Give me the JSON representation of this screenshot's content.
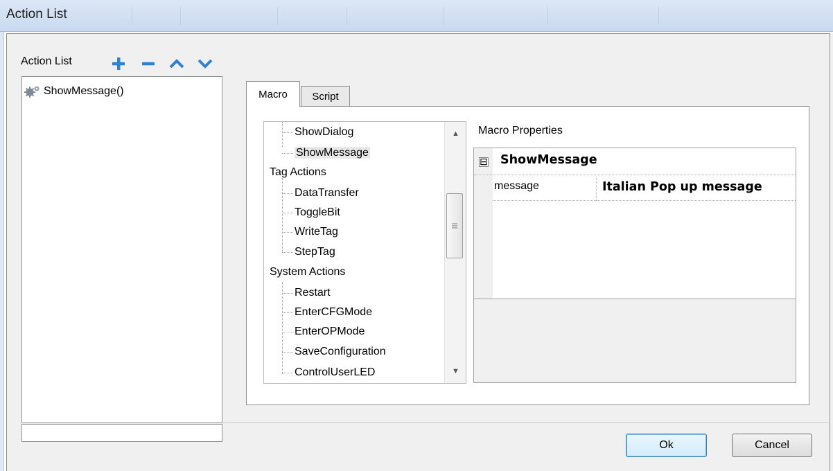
{
  "window": {
    "title": "Action List"
  },
  "action_list": {
    "label": "Action List",
    "toolbar": [
      {
        "name": "add-button",
        "icon": "plus-icon"
      },
      {
        "name": "remove-button",
        "icon": "minus-icon"
      },
      {
        "name": "move-up-button",
        "icon": "chevron-up-icon"
      },
      {
        "name": "move-down-button",
        "icon": "chevron-down-icon"
      }
    ],
    "items": [
      {
        "label": "ShowMessage()",
        "icon": "gears-icon"
      }
    ]
  },
  "tabs": [
    {
      "label": "Macro",
      "active": true
    },
    {
      "label": "Script",
      "active": false
    }
  ],
  "macro_tree": {
    "rows": [
      {
        "label": "ShowDialog",
        "level": 1
      },
      {
        "label": "ShowMessage",
        "level": 1,
        "selected": true
      },
      {
        "label": "Tag Actions",
        "level": 0
      },
      {
        "label": "DataTransfer",
        "level": 1
      },
      {
        "label": "ToggleBit",
        "level": 1
      },
      {
        "label": "WriteTag",
        "level": 1
      },
      {
        "label": "StepTag",
        "level": 1
      },
      {
        "label": "System Actions",
        "level": 0
      },
      {
        "label": "Restart",
        "level": 1
      },
      {
        "label": "EnterCFGMode",
        "level": 1
      },
      {
        "label": "EnterOPMode",
        "level": 1
      },
      {
        "label": "SaveConfiguration",
        "level": 1
      },
      {
        "label": "ControlUserLED",
        "level": 1
      }
    ]
  },
  "macro_properties": {
    "label": "Macro Properties",
    "category": "ShowMessage",
    "toggle": "⊟",
    "properties": [
      {
        "name": "message",
        "value": "Italian Pop up message"
      }
    ]
  },
  "buttons": {
    "ok": "Ok",
    "cancel": "Cancel"
  },
  "colors": {
    "accent": "#2f80d5",
    "selection": "#e8e8e8"
  }
}
